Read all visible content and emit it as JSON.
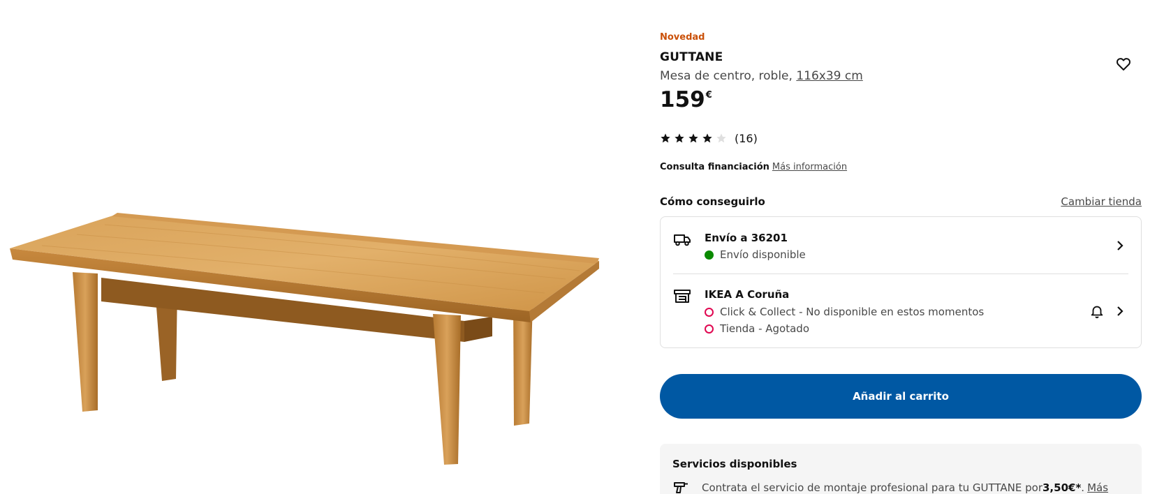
{
  "product": {
    "badge": "Novedad",
    "name": "GUTTANE",
    "description_prefix": "Mesa de centro, roble, ",
    "size_link": "116x39 cm",
    "price_value": "159",
    "price_currency": "€",
    "rating": {
      "stars": 4,
      "max": 5,
      "count_label": "(16)"
    },
    "image": "oak-coffee-table-photo"
  },
  "financing": {
    "label": "Consulta financiación",
    "link": "Más información"
  },
  "availability": {
    "heading": "Cómo conseguirlo",
    "change_store": "Cambiar tienda",
    "delivery": {
      "icon": "truck-icon",
      "title": "Envío a 36201",
      "status": "Envío disponible",
      "status_color": "#0a8a00"
    },
    "store": {
      "icon": "store-icon",
      "title": "IKEA A Coruña",
      "status_1": "Click & Collect - No disponible en estos momentos",
      "status_2": "Tienda - Agotado",
      "status_color": "#e00751"
    }
  },
  "cart": {
    "add_label": "Añadir al carrito",
    "color": "#0058a3"
  },
  "services": {
    "heading": "Servicios disponibles",
    "assembly_text": "Contrata el servicio de montaje profesional para tu GUTTANE por ",
    "assembly_price": "3,50€*",
    "assembly_after_price": ".",
    "more_link": "Más"
  },
  "accent": {
    "badge": "#ca5008"
  }
}
